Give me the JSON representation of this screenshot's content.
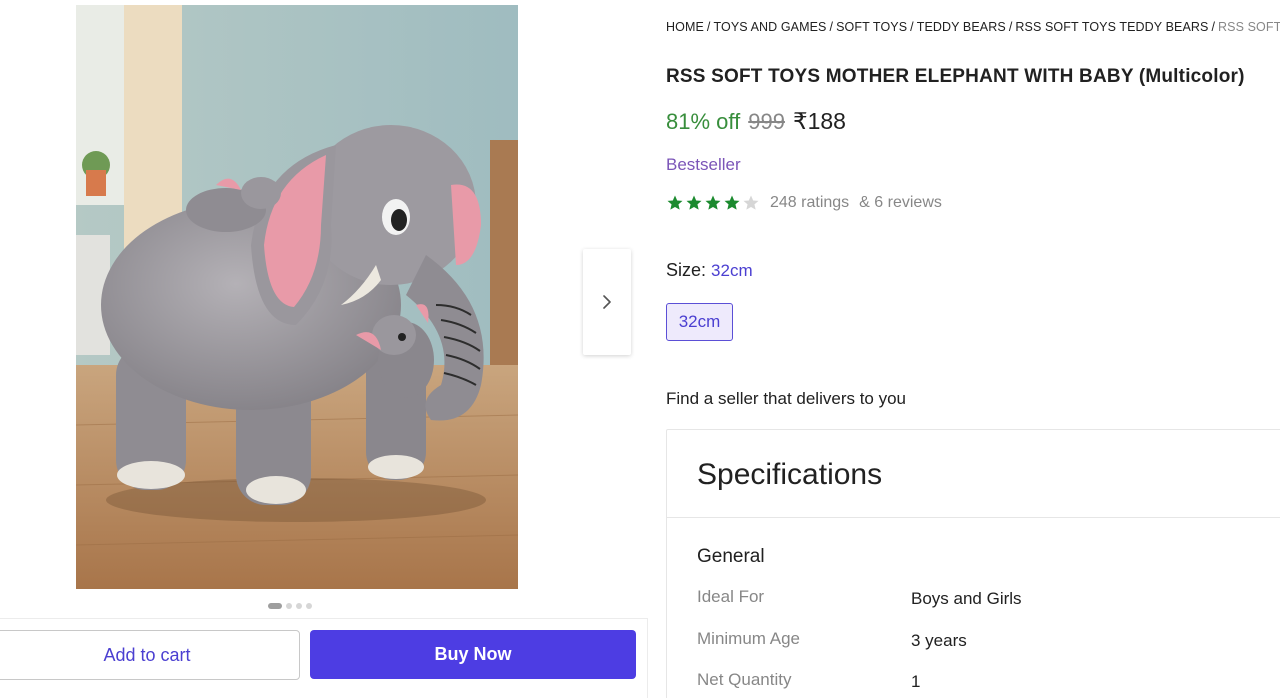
{
  "breadcrumb": [
    "HOME",
    "TOYS AND GAMES",
    "SOFT TOYS",
    "TEDDY BEARS",
    "RSS SOFT TOYS TEDDY BEARS",
    "RSS SOFT TOYS MOTHER ELEPHANT WITH BABY"
  ],
  "product": {
    "title": "RSS SOFT TOYS MOTHER ELEPHANT WITH BABY (Multicolor)",
    "discount": "81% off",
    "mrp": "999",
    "price": "₹188",
    "badge": "Bestseller",
    "rating_value": 4,
    "rating_max": 5,
    "ratings_count": "248 ratings",
    "reviews_count": "& 6 reviews"
  },
  "size": {
    "label": "Size:",
    "selected": "32cm",
    "options": [
      "32cm"
    ]
  },
  "seller": {
    "label": "Find a seller that delivers to you"
  },
  "gallery": {
    "total_images": 4,
    "active_index": 0
  },
  "actions": {
    "add_to_cart": "Add to cart",
    "buy_now": "Buy Now"
  },
  "specifications": {
    "title": "Specifications",
    "group": "General",
    "rows": [
      {
        "key": "Ideal For",
        "value": "Boys and Girls"
      },
      {
        "key": "Minimum Age",
        "value": "3 years"
      },
      {
        "key": "Net Quantity",
        "value": "1"
      }
    ]
  },
  "colors": {
    "accent": "#4d3de3",
    "discount_green": "#388e3c",
    "star_green": "#1b8a2e",
    "badge_purple": "#7b55b8"
  },
  "icons": {
    "carousel_next": "chevron-right-icon",
    "rating": "star-icon"
  }
}
